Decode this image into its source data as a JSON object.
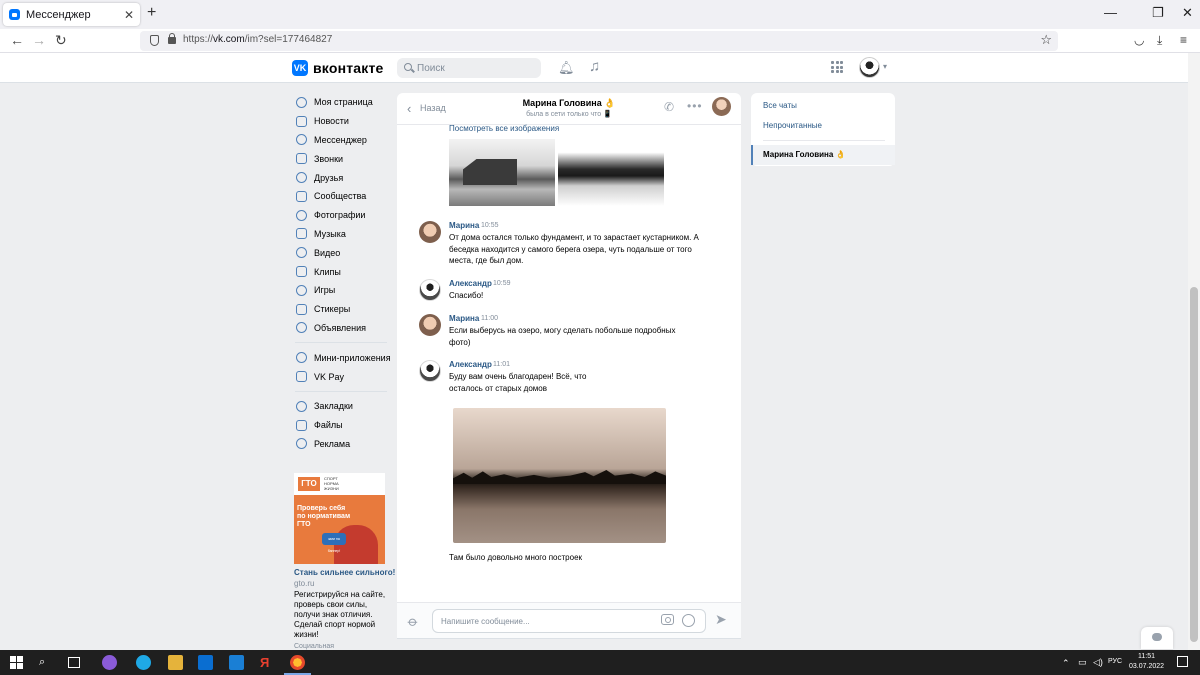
{
  "browser": {
    "tab_title": "Мессенджер",
    "tab_close": "✕",
    "new_tab": "+",
    "url_prefix": "https://",
    "url_host": "vk.com",
    "url_path": "/im?sel=177464827"
  },
  "header": {
    "logo_text": "вконтакте",
    "search_placeholder": "Поиск"
  },
  "menu": {
    "group1": [
      "Моя страница",
      "Новости",
      "Мессенджер",
      "Звонки",
      "Друзья",
      "Сообщества",
      "Фотографии",
      "Музыка",
      "Видео",
      "Клипы",
      "Игры",
      "Стикеры",
      "Объявления"
    ],
    "group2": [
      "Мини-приложения",
      "VK Pay"
    ],
    "group3": [
      "Закладки",
      "Файлы",
      "Реклама"
    ]
  },
  "ad": {
    "logo": "ГТО",
    "slogan": "СПОРТ НОРМА ЖИЗНИ",
    "banner_text": "Проверь себя по нормативам ГТО",
    "banner_button": "жми на баннер!",
    "title": "Стань сильнее сильного!",
    "site": "gto.ru",
    "description": "Регистрируйся на сайте, проверь свои силы, получи знак отличия. Сделай спорт нормой жизни!",
    "category": "Социальная"
  },
  "chat": {
    "back_label": "Назад",
    "peer_name": "Марина Головина 👌",
    "peer_status": "была в сети только что 📱",
    "see_all_images": "Посмотреть все изображения",
    "messages": [
      {
        "author": "Марина",
        "time": "10:55",
        "text": "От дома остался только фундамент, и то зарастает кустарником. А беседка находится у самого берега озера, чуть подальше от того места, где был дом."
      },
      {
        "author": "Александр",
        "time": "10:59",
        "text": "Спасибо!"
      },
      {
        "author": "Марина",
        "time": "11:00",
        "text": "Если выберусь на озеро, могу сделать побольше подробных фото)"
      },
      {
        "author": "Александр",
        "time": "11:01",
        "text": "Буду вам очень благодарен! Всё, что осталось от старых домов"
      }
    ],
    "tail_text": "Там было довольно много построек",
    "composer_placeholder": "Напишите сообщение..."
  },
  "right_panel": {
    "all_chats": "Все чаты",
    "unread": "Непрочитанные",
    "active_chat": "Марина Головина 👌"
  },
  "taskbar": {
    "lang": "РУС",
    "time": "11:51",
    "date": "03.07.2022"
  },
  "colors": {
    "vk_blue": "#0077ff",
    "link": "#2a5885",
    "bg": "#edeef0"
  }
}
